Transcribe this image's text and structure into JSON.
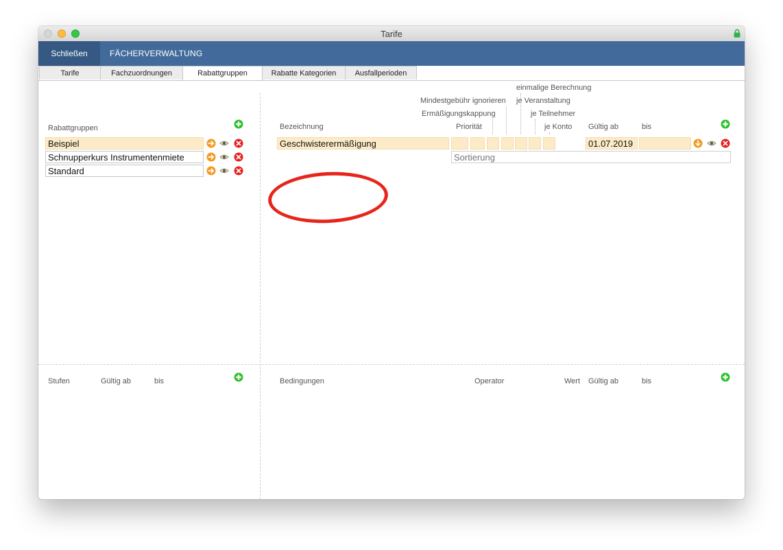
{
  "window": {
    "title": "Tarife"
  },
  "nav": {
    "close_label": "Schließen",
    "section_title": "FÄCHERVERWALTUNG"
  },
  "tabs": [
    {
      "label": "Tarife"
    },
    {
      "label": "Fachzuordnungen"
    },
    {
      "label": "Rabattgruppen",
      "active": true
    },
    {
      "label": "Rabatte Kategorien"
    },
    {
      "label": "Ausfallperioden"
    }
  ],
  "left_top": {
    "header": "Rabattgruppen",
    "items": [
      {
        "label": "Beispiel",
        "selected": true
      },
      {
        "label": "Schnupperkurs Instrumentenmiete"
      },
      {
        "label": "Standard"
      }
    ]
  },
  "right_top": {
    "headers": {
      "einmalige": "einmalige Berechnung",
      "mindest": "Mindestgebühr ignorieren",
      "veranstaltung": "je Veranstaltung",
      "kappung": "Ermäßigungskappung",
      "teilnehmer": "je Teilnehmer",
      "bezeichnung": "Bezeichnung",
      "prioritaet": "Priorität",
      "konto": "je Konto",
      "gueltig_ab": "Gültig ab",
      "bis": "bis"
    },
    "row": {
      "bezeichnung": "Geschwisterermäßigung",
      "gueltig_ab": "01.07.2019",
      "bis": ""
    },
    "sortierung_placeholder": "Sortierung"
  },
  "left_bottom": {
    "stufen": "Stufen",
    "gueltig_ab": "Gültig ab",
    "bis": "bis"
  },
  "right_bottom": {
    "bedingungen": "Bedingungen",
    "operator": "Operator",
    "wert": "Wert",
    "gueltig_ab": "Gültig ab",
    "bis": "bis"
  },
  "icons": {
    "add": "plus-circle-icon",
    "goto": "arrow-right-circle-icon",
    "view": "eye-icon",
    "delete": "x-circle-icon",
    "down": "arrow-down-circle-icon"
  },
  "colors": {
    "nav": "#426b9b",
    "nav_close": "#355983",
    "field_highlight": "#fdebc8",
    "add_green": "#2ec02e",
    "go_orange": "#f39a1e",
    "delete_red": "#e5211e",
    "annotation_red": "#e8251b"
  }
}
